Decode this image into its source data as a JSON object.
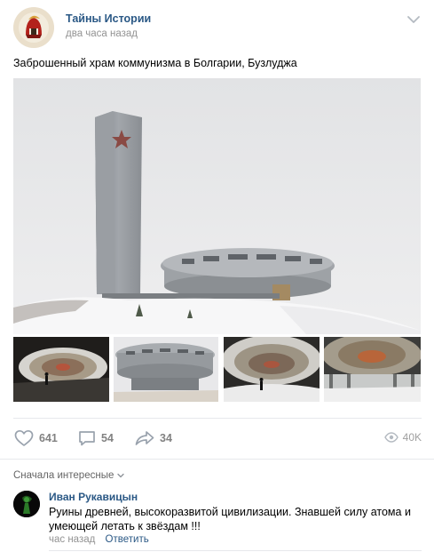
{
  "post": {
    "author": "Тайны Истории",
    "time": "два часа назад",
    "text": "Заброшенный храм коммунизма в Болгарии, Бузлуджа"
  },
  "actions": {
    "likes": "641",
    "comments": "54",
    "shares": "34",
    "views": "40K"
  },
  "comments_section": {
    "sort_label": "Сначала интересные",
    "comment": {
      "author": "Иван Рукавицын",
      "text": "Руины древней, высокоразвитой цивилизации. Знавшей силу атома и умеющей летать к звёздам !!!",
      "time": "час назад",
      "reply_label": "Ответить"
    }
  },
  "colors": {
    "link": "#2a5885",
    "muted": "#939393",
    "icon": "#99a2ad",
    "divider": "#e7e8ec"
  },
  "icons": [
    "chevron-down-icon",
    "heart-icon",
    "comment-icon",
    "share-icon",
    "eye-icon"
  ]
}
